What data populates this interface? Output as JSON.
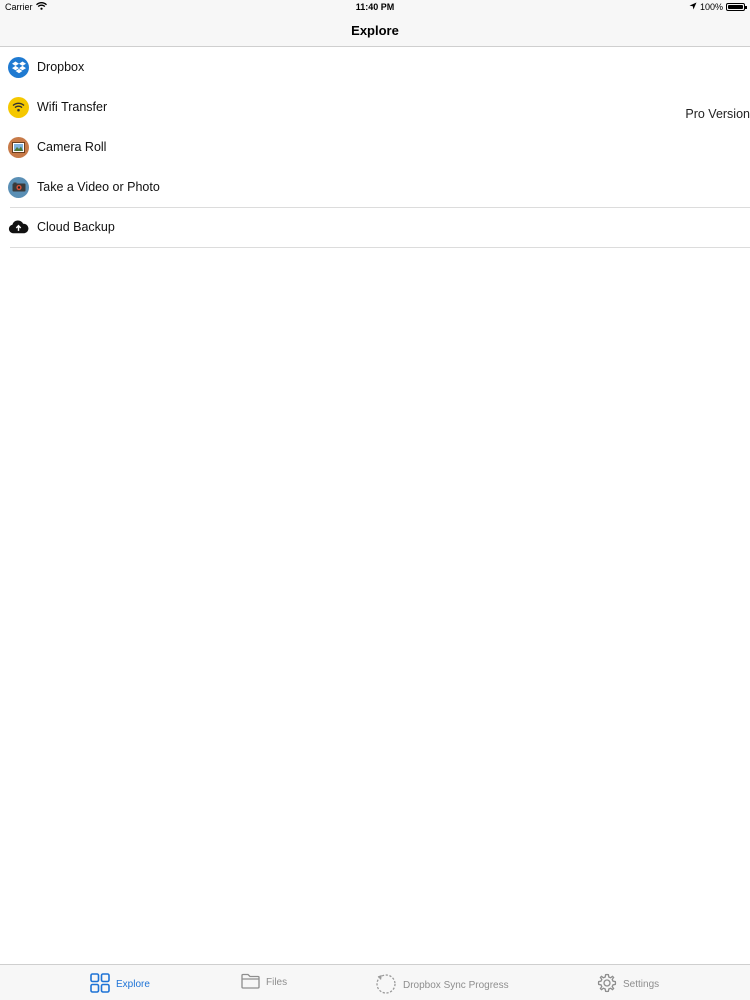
{
  "status_bar": {
    "carrier": "Carrier",
    "time": "11:40 PM",
    "battery": "100%",
    "icons": [
      "wifi-icon",
      "location-arrow-icon",
      "battery-icon"
    ]
  },
  "nav": {
    "title": "Explore"
  },
  "list": {
    "items": [
      {
        "label": "Dropbox",
        "icon": "dropbox-icon",
        "color": "#1f7ad1"
      },
      {
        "label": "Wifi Transfer",
        "icon": "wifi-transfer-icon",
        "color": "#f5c800"
      },
      {
        "label": "Camera Roll",
        "icon": "camera-roll-icon",
        "color": "#c77a48"
      },
      {
        "label": "Take a Video or Photo",
        "icon": "camera-icon",
        "color": "#5a8fb5"
      },
      {
        "label": "Cloud Backup",
        "icon": "cloud-upload-icon",
        "color": "#111111"
      }
    ]
  },
  "pro_version": "Pro Version",
  "tabs": [
    {
      "label": "Explore",
      "icon": "grid-icon",
      "active": true
    },
    {
      "label": "Files",
      "icon": "folder-icon",
      "active": false
    },
    {
      "label": "Dropbox Sync Progress",
      "icon": "sync-icon",
      "active": false
    },
    {
      "label": "Settings",
      "icon": "gear-icon",
      "active": false
    }
  ],
  "colors": {
    "accent": "#1e73d6",
    "inactive_tab": "#8e8e8e",
    "bar_background": "#f7f7f7",
    "separator": "#dcdcdc"
  }
}
